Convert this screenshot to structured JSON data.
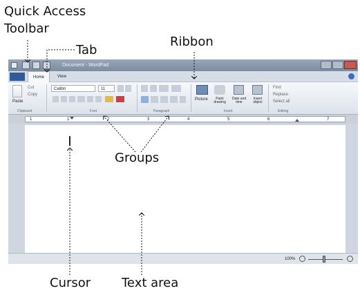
{
  "callouts": {
    "quick_access_toolbar_line1": "Quick Access",
    "quick_access_toolbar_line2": "Toolbar",
    "tab": "Tab",
    "ribbon": "Ribbon",
    "groups": "Groups",
    "cursor": "Cursor",
    "text_area": "Text area"
  },
  "window": {
    "title": "Document - WordPad"
  },
  "tabs": [
    {
      "label": "Home"
    },
    {
      "label": "View"
    }
  ],
  "ribbon": {
    "clipboard": {
      "paste": "Paste",
      "cut": "Cut",
      "copy": "Copy",
      "label": "Clipboard"
    },
    "font": {
      "family": "Calibri",
      "size": "11",
      "label": "Font"
    },
    "paragraph": {
      "label": "Paragraph"
    },
    "insert": {
      "picture": "Picture",
      "paint_drawing": "Paint drawing",
      "date_time": "Date and time",
      "insert_object": "Insert object",
      "label": "Insert"
    },
    "editing": {
      "find": "Find",
      "replace": "Replace",
      "select_all": "Select all",
      "label": "Editing"
    }
  },
  "ruler": {
    "marks": [
      "1",
      "1",
      "2",
      "3",
      "4",
      "5",
      "6",
      "7"
    ]
  },
  "status": {
    "zoom": "100%"
  },
  "colors": {
    "callout_text": "#111111",
    "window_frame": "#7d8ba0",
    "ribbon": "#eef1f5"
  }
}
